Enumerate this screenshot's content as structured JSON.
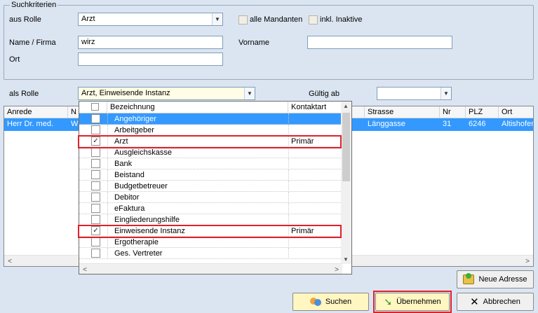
{
  "search": {
    "group_title": "Suchkriterien",
    "aus_rolle_label": "aus Rolle",
    "aus_rolle_value": "Arzt",
    "alle_mandanten_label": "alle Mandanten",
    "inkl_inaktive_label": "inkl. Inaktive",
    "name_label": "Name / Firma",
    "name_value": "wirz",
    "vorname_label": "Vorname",
    "vorname_value": "",
    "ort_label": "Ort",
    "ort_value": "",
    "als_rolle_label": "als Rolle",
    "als_rolle_value": "Arzt, Einweisende Instanz",
    "gueltig_ab_label": "Gültig ab",
    "gueltig_ab_value": ""
  },
  "grid": {
    "columns": [
      "Anrede",
      "N",
      "Strasse",
      "Nr",
      "PLZ",
      "Ort"
    ],
    "rows": [
      {
        "anrede": "Herr Dr. med.",
        "n": "W",
        "strasse": "Länggasse",
        "nr": "31",
        "plz": "6246",
        "ort": "Altishofen"
      }
    ]
  },
  "dropdown": {
    "header_name": "Bezeichnung",
    "header_kontaktart": "Kontaktart",
    "items": [
      {
        "label": "Angehöriger",
        "checked": false,
        "kontaktart": ""
      },
      {
        "label": "Arbeitgeber",
        "checked": false,
        "kontaktart": ""
      },
      {
        "label": "Arzt",
        "checked": true,
        "kontaktart": "Primär"
      },
      {
        "label": "Ausgleichskasse",
        "checked": false,
        "kontaktart": ""
      },
      {
        "label": "Bank",
        "checked": false,
        "kontaktart": ""
      },
      {
        "label": "Beistand",
        "checked": false,
        "kontaktart": ""
      },
      {
        "label": "Budgetbetreuer",
        "checked": false,
        "kontaktart": ""
      },
      {
        "label": "Debitor",
        "checked": false,
        "kontaktart": ""
      },
      {
        "label": "eFaktura",
        "checked": false,
        "kontaktart": ""
      },
      {
        "label": "Eingliederungshilfe",
        "checked": false,
        "kontaktart": ""
      },
      {
        "label": "Einweisende Instanz",
        "checked": true,
        "kontaktart": "Primär"
      },
      {
        "label": "Ergotherapie",
        "checked": false,
        "kontaktart": ""
      },
      {
        "label": "Ges. Vertreter",
        "checked": false,
        "kontaktart": ""
      }
    ]
  },
  "buttons": {
    "neue_adresse": "Neue Adresse",
    "suchen": "Suchen",
    "uebernehmen": "Übernehmen",
    "abbrechen": "Abbrechen"
  },
  "colors": {
    "highlight": "#e0202a",
    "selection": "#3399ff"
  }
}
